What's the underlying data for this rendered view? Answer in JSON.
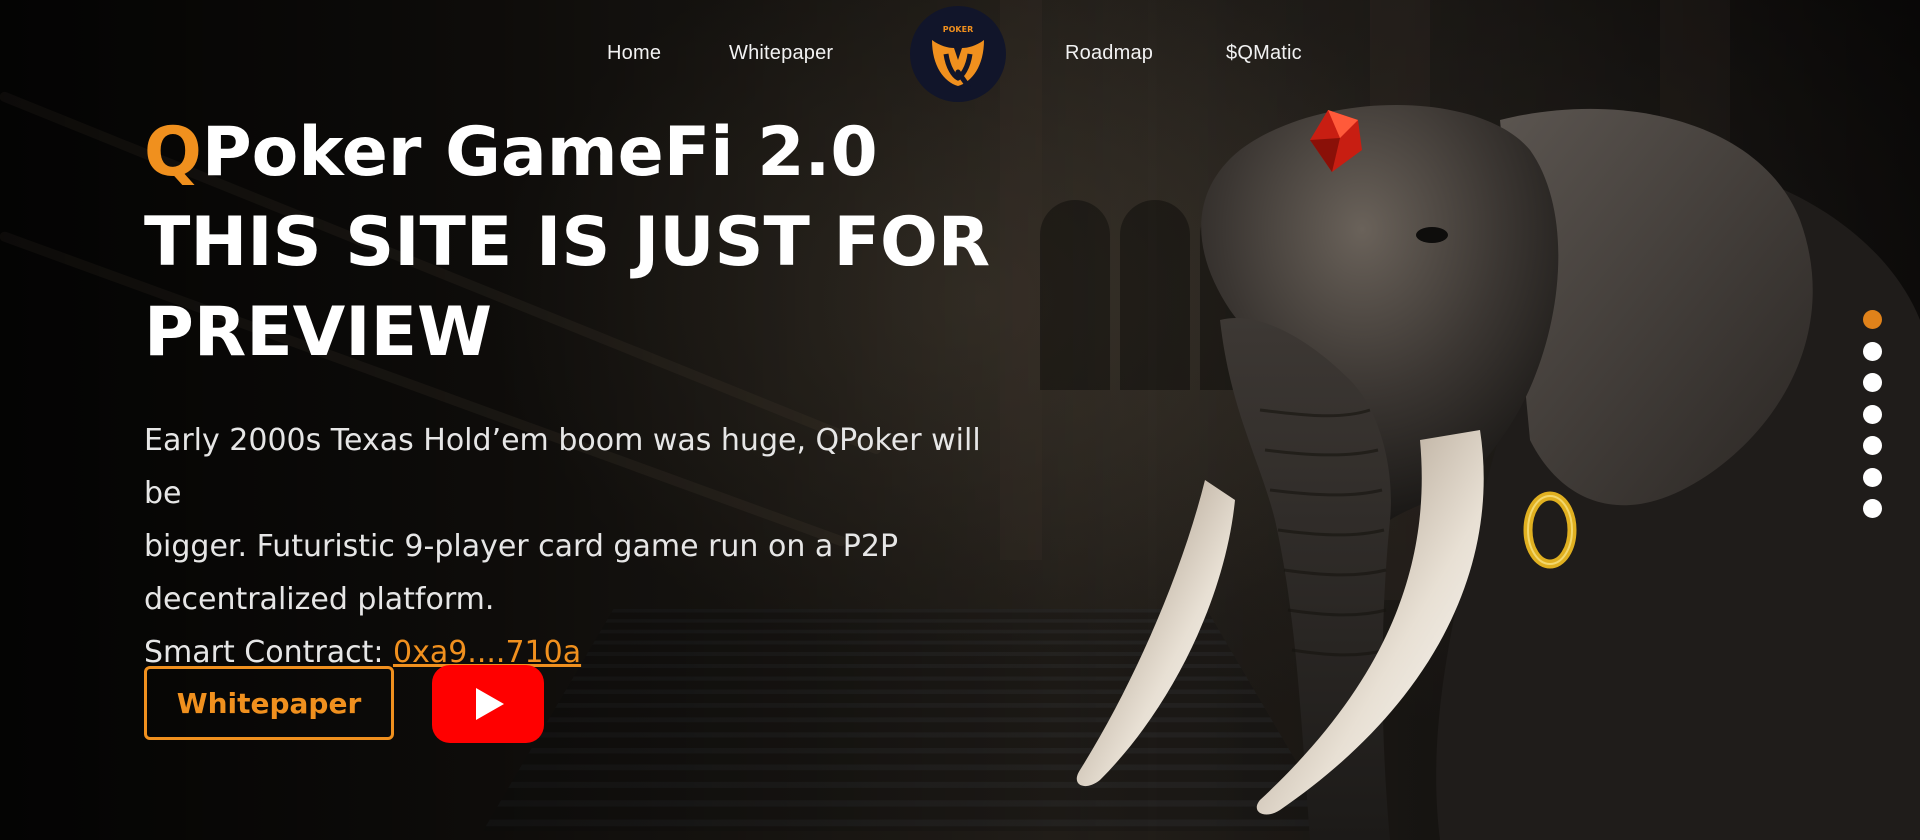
{
  "nav": {
    "items": [
      "Home",
      "Whitepaper",
      "Roadmap",
      "$QMatic"
    ],
    "logo_text": "POKER"
  },
  "hero": {
    "title_accent": "Q",
    "title_rest": "Poker GameFi 2.0",
    "title_line2": "THIS SITE IS JUST FOR",
    "title_line3": "PREVIEW",
    "description_line1": "Early 2000s Texas Hold’em boom was huge, QPoker will be",
    "description_line2": "bigger. Futuristic 9-player card game run on a P2P",
    "description_line3": "decentralized platform.",
    "contract_label": "Smart Contract: ",
    "contract_address": "0xa9....710a"
  },
  "buttons": {
    "whitepaper_label": "Whitepaper",
    "youtube_icon": "youtube-play-icon"
  },
  "slider": {
    "total": 7,
    "active_index": 0
  },
  "colors": {
    "accent": "#f0901e",
    "youtube": "#ff0000",
    "background": "#0b0a09"
  }
}
